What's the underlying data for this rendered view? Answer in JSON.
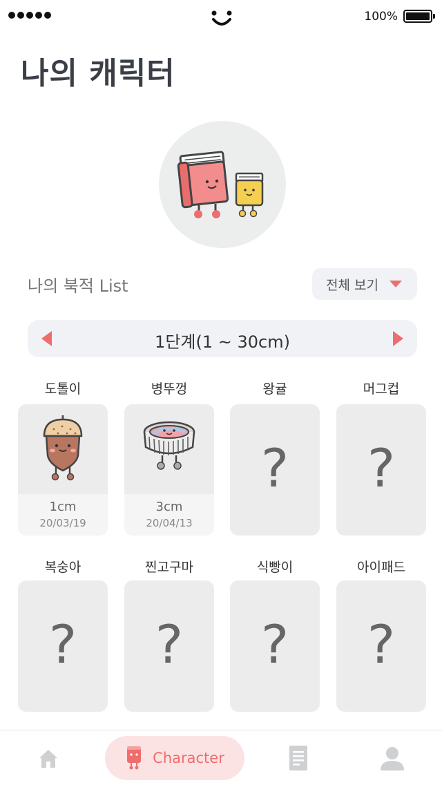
{
  "status": {
    "battery": "100%"
  },
  "page": {
    "title": "나의 캐릭터"
  },
  "list": {
    "title": "나의 북적 List",
    "view_all": "전체 보기"
  },
  "stage": {
    "label": "1단계(1 ~ 30cm)"
  },
  "items": [
    {
      "name": "도톨이",
      "unlocked": true,
      "size": "1cm",
      "date": "20/03/19",
      "icon": "acorn-character-icon"
    },
    {
      "name": "병뚜껑",
      "unlocked": true,
      "size": "3cm",
      "date": "20/04/13",
      "icon": "bottle-cap-character-icon"
    },
    {
      "name": "왕귤",
      "unlocked": false,
      "placeholder": "?"
    },
    {
      "name": "머그컵",
      "unlocked": false,
      "placeholder": "?"
    },
    {
      "name": "복숭아",
      "unlocked": false,
      "placeholder": "?"
    },
    {
      "name": "찐고구마",
      "unlocked": false,
      "placeholder": "?"
    },
    {
      "name": "식빵이",
      "unlocked": false,
      "placeholder": "?"
    },
    {
      "name": "아이패드",
      "unlocked": false,
      "placeholder": "?"
    }
  ],
  "tabs": {
    "home_icon": "home-icon",
    "character_label": "Character",
    "document_icon": "document-icon",
    "profile_icon": "profile-icon"
  },
  "colors": {
    "accent": "#ee6d6d",
    "card_bg": "#ececec",
    "title": "#3a3f47"
  }
}
